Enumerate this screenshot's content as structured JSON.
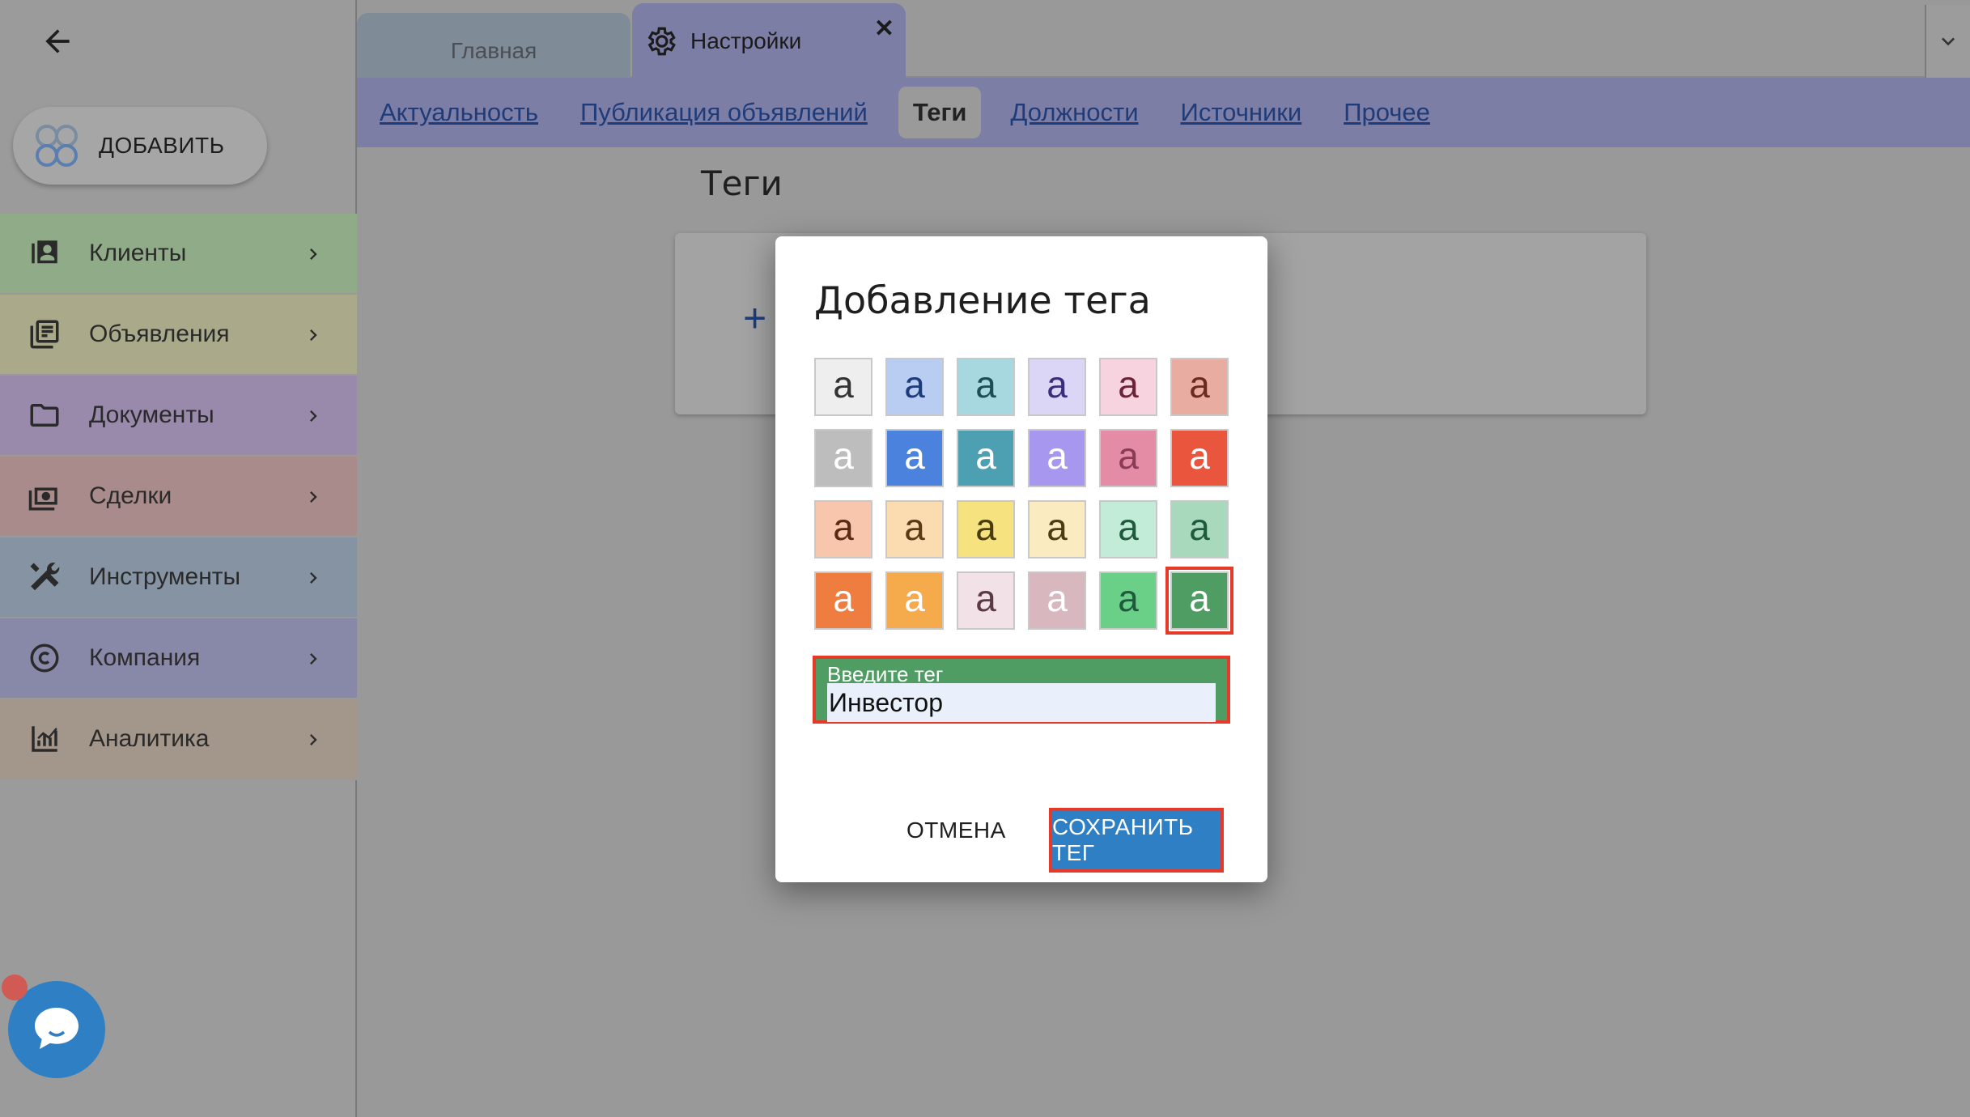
{
  "sidebar": {
    "back_icon": "arrow-left-icon",
    "add_button": {
      "label": "ДОБАВИТЬ",
      "icon": "app-logo-icon"
    },
    "items": [
      {
        "label": "Клиенты",
        "icon": "contacts-icon",
        "color": "#8fab87"
      },
      {
        "label": "Объявления",
        "icon": "listings-icon",
        "color": "#aaa98a"
      },
      {
        "label": "Документы",
        "icon": "folder-icon",
        "color": "#9989aa"
      },
      {
        "label": "Сделки",
        "icon": "money-icon",
        "color": "#a88b8a"
      },
      {
        "label": "Инструменты",
        "icon": "tools-icon",
        "color": "#8593a3"
      },
      {
        "label": "Компания",
        "icon": "copyright-icon",
        "color": "#8889a8"
      },
      {
        "label": "Аналитика",
        "icon": "analytics-icon",
        "color": "#a3968a"
      }
    ],
    "chat_icon": "chat-icon"
  },
  "tabs": [
    {
      "label": "Главная",
      "active": false
    },
    {
      "label": "Настройки",
      "active": true,
      "icon": "gear-icon",
      "close": "✕"
    }
  ],
  "subnav": [
    {
      "label": "Актуальность",
      "active": false
    },
    {
      "label": "Публикация объявлений",
      "active": false
    },
    {
      "label": "Теги",
      "active": true
    },
    {
      "label": "Должности",
      "active": false
    },
    {
      "label": "Источники",
      "active": false
    },
    {
      "label": "Прочее",
      "active": false
    }
  ],
  "page": {
    "title": "Теги",
    "add_symbol": "+"
  },
  "dialog": {
    "title": "Добавление тега",
    "swatch_letter": "a",
    "swatches": [
      {
        "bg": "#eeeeee",
        "fg": "#333333"
      },
      {
        "bg": "#b9cdf2",
        "fg": "#1f3c7a"
      },
      {
        "bg": "#a8d8df",
        "fg": "#1c4e56"
      },
      {
        "bg": "#dcd6f6",
        "fg": "#3b2d7a"
      },
      {
        "bg": "#f6d3de",
        "fg": "#6b2339"
      },
      {
        "bg": "#e8aca0",
        "fg": "#6b2a1f"
      },
      {
        "bg": "#bdbdbd",
        "fg": "#ffffff"
      },
      {
        "bg": "#4a82de",
        "fg": "#ffffff"
      },
      {
        "bg": "#4da0b1",
        "fg": "#ffffff"
      },
      {
        "bg": "#a897ee",
        "fg": "#ffffff"
      },
      {
        "bg": "#e48ca5",
        "fg": "#8a3b55"
      },
      {
        "bg": "#e9553d",
        "fg": "#ffffff"
      },
      {
        "bg": "#f8c6ac",
        "fg": "#5a2a14"
      },
      {
        "bg": "#fbdcb0",
        "fg": "#5a3a14"
      },
      {
        "bg": "#f6e27e",
        "fg": "#4a3d0a"
      },
      {
        "bg": "#fbebc0",
        "fg": "#4a3d14"
      },
      {
        "bg": "#c3ecd8",
        "fg": "#1f5a3d"
      },
      {
        "bg": "#a9d9bd",
        "fg": "#1f5a3d"
      },
      {
        "bg": "#ef7d3f",
        "fg": "#ffffff"
      },
      {
        "bg": "#f5ab4b",
        "fg": "#ffffff"
      },
      {
        "bg": "#f2e1e6",
        "fg": "#5a3a45"
      },
      {
        "bg": "#d8b7be",
        "fg": "#ffffff"
      },
      {
        "bg": "#6bd087",
        "fg": "#1f5a3d"
      },
      {
        "bg": "#4f9d63",
        "fg": "#ffffff",
        "selected": true
      }
    ],
    "input": {
      "label": "Введите тег",
      "value": "Инвестор"
    },
    "cancel_label": "ОТМЕНА",
    "save_label": "СОХРАНИТЬ ТЕГ"
  },
  "colors": {
    "accent": "#2f7fc4",
    "highlight": "#e53a2a",
    "subnav_bg": "#7d7ea6"
  }
}
